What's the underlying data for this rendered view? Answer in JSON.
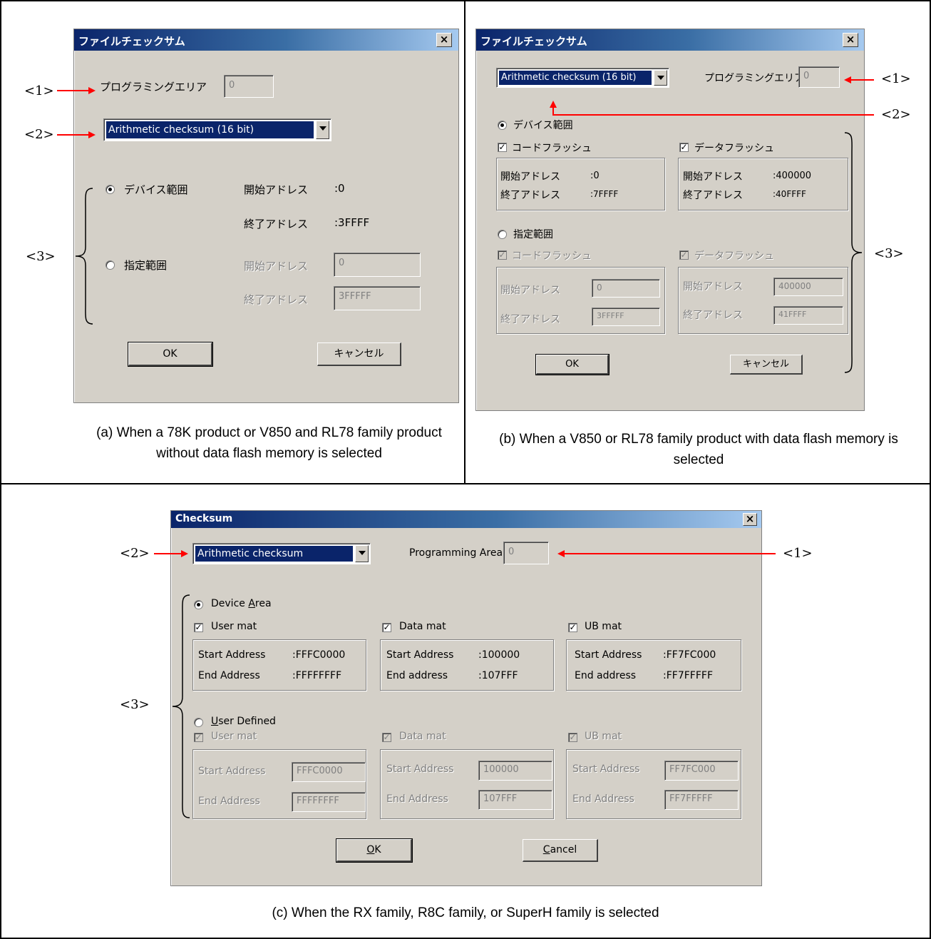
{
  "panel_a": {
    "dialog_title": "ファイルチェックサム",
    "close_glyph": "×",
    "prog_area_label": "プログラミングエリア",
    "prog_area_value": "0",
    "checksum_type": "Arithmetic checksum (16 bit)",
    "device_range": "デバイス範囲",
    "start_label": "開始アドレス",
    "start_value": ":0",
    "end_label": "終了アドレス",
    "end_value": ":3FFFF",
    "specified_range": "指定範囲",
    "spec_start_label": "開始アドレス",
    "spec_start_value": "0",
    "spec_end_label": "終了アドレス",
    "spec_end_value": "3FFFFF",
    "ok": "OK",
    "cancel": "キャンセル",
    "caption": "(a) When a 78K product or V850 and RL78 family product without data flash memory is selected",
    "marker_1": "<1>",
    "marker_2": "<2>",
    "marker_3": "<3>"
  },
  "panel_b": {
    "dialog_title": "ファイルチェックサム",
    "close_glyph": "×",
    "checksum_type": "Arithmetic checksum (16 bit)",
    "prog_area_label": "プログラミングエリア",
    "prog_area_value": "0",
    "device_range": "デバイス範囲",
    "code_flash": "コードフラッシュ",
    "data_flash": "データフラッシュ",
    "code_start_label": "開始アドレス",
    "code_start_value": ":0",
    "code_end_label": "終了アドレス",
    "code_end_value": ":7FFFF",
    "data_start_label": "開始アドレス",
    "data_start_value": ":400000",
    "data_end_label": "終了アドレス",
    "data_end_value": ":40FFFF",
    "specified_range": "指定範囲",
    "spec_code_flash": "コードフラッシュ",
    "spec_data_flash": "データフラッシュ",
    "spec_code_start_label": "開始アドレス",
    "spec_code_start_value": "0",
    "spec_code_end_label": "終了アドレス",
    "spec_code_end_value": "3FFFFF",
    "spec_data_start_label": "開始アドレス",
    "spec_data_start_value": "400000",
    "spec_data_end_label": "終了アドレス",
    "spec_data_end_value": "41FFFF",
    "ok": "OK",
    "cancel": "キャンセル",
    "caption": "(b) When a V850 or RL78 family product with data flash memory is selected",
    "marker_1": "<1>",
    "marker_2": "<2>",
    "marker_3": "<3>"
  },
  "panel_c": {
    "dialog_title": "Checksum",
    "close_glyph": "×",
    "checksum_type": "Arithmetic checksum",
    "prog_area_label": "Programming Area",
    "prog_area_value": "0",
    "device_area_pre": "Device ",
    "device_area_ul": "A",
    "device_area_post": "rea",
    "user_mat": "User mat",
    "data_mat": "Data mat",
    "ub_mat": "UB mat",
    "um_start_label": "Start Address",
    "um_start_value": ":FFFC0000",
    "um_end_label": "End Address",
    "um_end_value": ":FFFFFFFF",
    "dm_start_label": "Start Address",
    "dm_start_value": ":100000",
    "dm_end_label": "End address",
    "dm_end_value": ":107FFF",
    "ub_start_label": "Start Address",
    "ub_start_value": ":FF7FC000",
    "ub_end_label": "End address",
    "ub_end_value": ":FF7FFFFF",
    "user_defined_ul": "U",
    "user_defined_post": "ser Defined",
    "spec_user_mat": "User mat",
    "spec_data_mat": "Data mat",
    "spec_ub_mat": "UB mat",
    "spec_um_start_label": "Start Address",
    "spec_um_start_value": "FFFC0000",
    "spec_um_end_label": "End Address",
    "spec_um_end_value": "FFFFFFFF",
    "spec_dm_start_label": "Start Address",
    "spec_dm_start_value": "100000",
    "spec_dm_end_label": "End Address",
    "spec_dm_end_value": "107FFF",
    "spec_ub_start_label": "Start Address",
    "spec_ub_start_value": "FF7FC000",
    "spec_ub_end_label": "End Address",
    "spec_ub_end_value": "FF7FFFFF",
    "ok_ul": "O",
    "ok_post": "K",
    "cancel_ul": "C",
    "cancel_post": "ancel",
    "caption": "(c) When the RX family, R8C family, or SuperH family is selected",
    "marker_1": "<1>",
    "marker_2": "<2>",
    "marker_3": "<3>"
  },
  "colors": {
    "dialog_bg": "#d4d0c8",
    "title_start": "#0a246a",
    "title_end": "#a6caf0",
    "arrow": "#ff0000",
    "disabled_text": "#808080"
  }
}
